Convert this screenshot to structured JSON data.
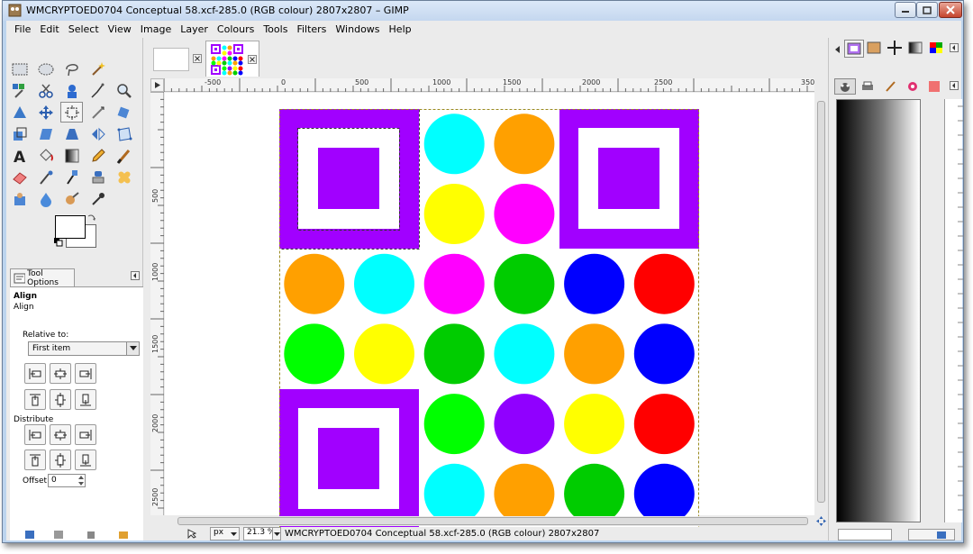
{
  "window": {
    "title": "WMCRYPTOED0704 Conceptual 58.xcf-285.0 (RGB colour) 2807x2807 – GIMP"
  },
  "menubar": {
    "items": [
      "File",
      "Edit",
      "Select",
      "View",
      "Image",
      "Layer",
      "Colours",
      "Tools",
      "Filters",
      "Windows",
      "Help"
    ]
  },
  "tool_options": {
    "tab_label": "Tool Options",
    "header": "Align",
    "subheader": "Align",
    "relative_label": "Relative to:",
    "relative_value": "First item",
    "distribute_label": "Distribute",
    "offset_label": "Offset:",
    "offset_value": "0"
  },
  "rulers": {
    "top": [
      "-500",
      "0",
      "500",
      "1000",
      "1500",
      "2000",
      "2500",
      "350"
    ],
    "left": [
      "500",
      "1000",
      "1500",
      "2000",
      "2500"
    ]
  },
  "statusbar": {
    "unit": "px",
    "zoom": "21.3 %",
    "text": "WMCRYPTOED0704 Conceptual 58.xcf-285.0 (RGB colour) 2807x2807"
  },
  "colors": {
    "purple": "#a100ff",
    "cyan": "#00ffff",
    "orange": "#ffa000",
    "yellow": "#ffff00",
    "magenta": "#ff00ff",
    "green": "#00cc00",
    "blue": "#0000ff",
    "red": "#ff0000",
    "lime": "#00ff00",
    "violet": "#9000ff"
  },
  "canvas_circles": [
    [
      "cyan",
      "orange"
    ],
    [
      "yellow",
      "magenta"
    ],
    [
      "orange",
      "cyan",
      "magenta",
      "green",
      "blue",
      "red"
    ],
    [
      "lime",
      "yellow",
      "green",
      "cyan",
      "orange",
      "blue"
    ],
    [
      "lime",
      "violet",
      "yellow",
      "red"
    ],
    [
      "cyan",
      "orange",
      "green",
      "blue"
    ]
  ]
}
